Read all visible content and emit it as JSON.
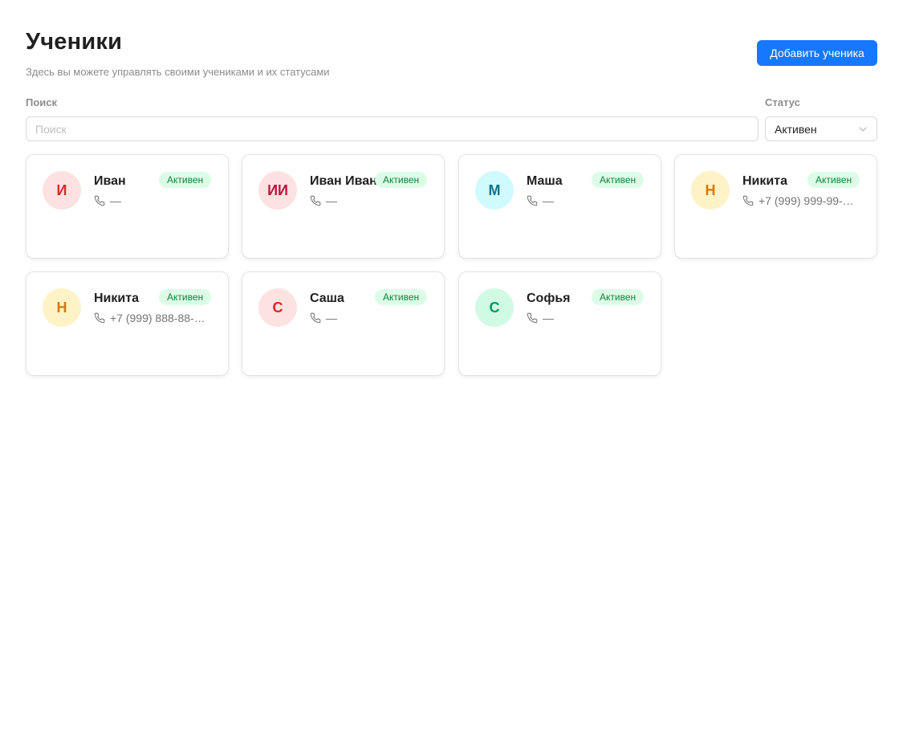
{
  "header": {
    "title": "Ученики",
    "subtitle": "Здесь вы можете управлять своими учениками и их статусами",
    "add_button_label": "Добавить ученика"
  },
  "filters": {
    "search_label": "Поиск",
    "search_placeholder": "Поиск",
    "search_value": "",
    "status_label": "Статус",
    "status_value": "Активен",
    "status_icon": "chevron-down-icon"
  },
  "colors": {
    "accent": "#1677ff",
    "badge_bg": "#dcfce7",
    "badge_text": "#15803d"
  },
  "students": [
    {
      "initials": "И",
      "name": "Иван",
      "status": "Активен",
      "phone": "—",
      "phone_icon": "phone-icon",
      "avatar_bg": "#fde2e2",
      "avatar_fg": "#dc2626"
    },
    {
      "initials": "ИИ",
      "name": "Иван Иван",
      "status": "Активен",
      "phone": "—",
      "phone_icon": "phone-icon",
      "avatar_bg": "#fde2e2",
      "avatar_fg": "#be123c"
    },
    {
      "initials": "М",
      "name": "Маша",
      "status": "Активен",
      "phone": "—",
      "phone_icon": "phone-icon",
      "avatar_bg": "#cffafe",
      "avatar_fg": "#0e7490"
    },
    {
      "initials": "Н",
      "name": "Никита",
      "status": "Активен",
      "phone": "+7 (999) 999-99-…",
      "phone_icon": "phone-icon",
      "avatar_bg": "#fef3c7",
      "avatar_fg": "#d97706"
    },
    {
      "initials": "Н",
      "name": "Никита",
      "status": "Активен",
      "phone": "+7 (999) 888-88-…",
      "phone_icon": "phone-icon",
      "avatar_bg": "#fef3c7",
      "avatar_fg": "#d97706"
    },
    {
      "initials": "С",
      "name": "Саша",
      "status": "Активен",
      "phone": "—",
      "phone_icon": "phone-icon",
      "avatar_bg": "#fde2e2",
      "avatar_fg": "#dc2626"
    },
    {
      "initials": "С",
      "name": "Софья",
      "status": "Активен",
      "phone": "—",
      "phone_icon": "phone-icon",
      "avatar_bg": "#d1fae5",
      "avatar_fg": "#059669"
    }
  ]
}
